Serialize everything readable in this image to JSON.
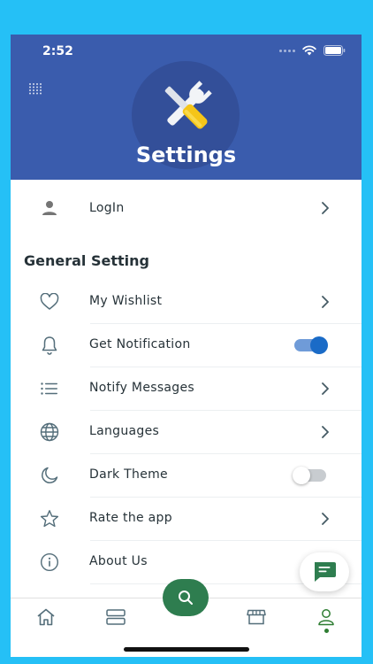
{
  "status_bar": {
    "time": "2:52"
  },
  "header": {
    "title": "Settings"
  },
  "login": {
    "label": "LogIn"
  },
  "general": {
    "section_title": "General Setting",
    "items": [
      {
        "label": "My Wishlist",
        "icon": "heart-icon",
        "control": "chevron"
      },
      {
        "label": "Get Notification",
        "icon": "bell-icon",
        "control": "toggle",
        "on": true
      },
      {
        "label": "Notify Messages",
        "icon": "list-icon",
        "control": "chevron"
      },
      {
        "label": "Languages",
        "icon": "globe-icon",
        "control": "chevron"
      },
      {
        "label": "Dark Theme",
        "icon": "moon-icon",
        "control": "toggle",
        "on": false
      },
      {
        "label": "Rate the app",
        "icon": "star-icon",
        "control": "chevron"
      },
      {
        "label": "About Us",
        "icon": "info-icon",
        "control": "none"
      }
    ]
  },
  "bottom_nav": {
    "items": [
      "home-icon",
      "categories-icon",
      "search-icon",
      "store-icon",
      "profile-icon"
    ],
    "active": "profile-icon"
  },
  "colors": {
    "header_bg": "#3a5cad",
    "page_bg": "#25c0f6",
    "accent_green": "#2e7d4f",
    "toggle_on": "#1a6bc7"
  }
}
